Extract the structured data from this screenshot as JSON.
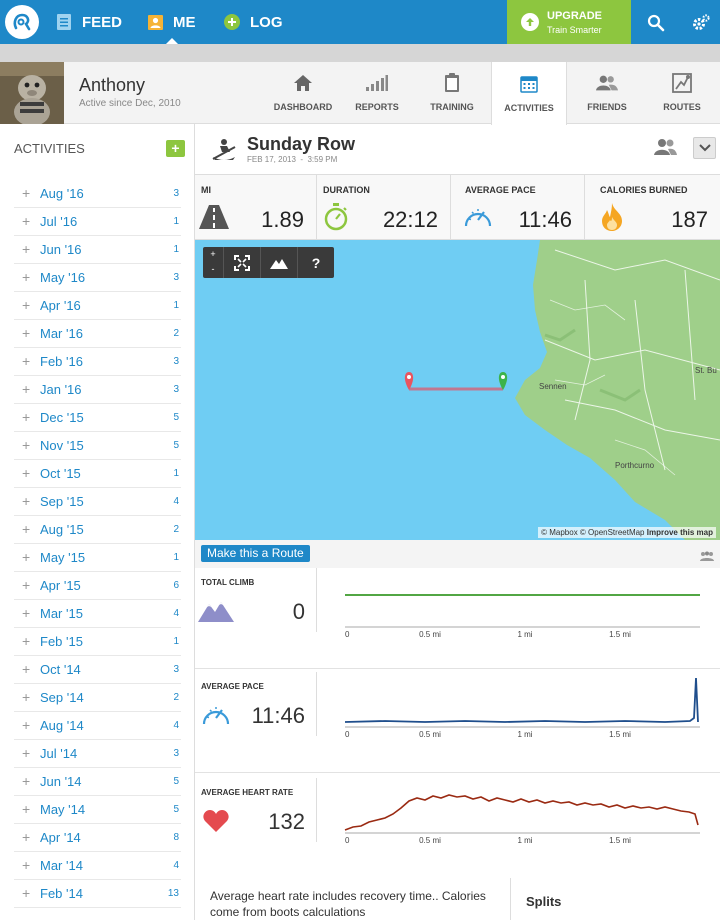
{
  "nav": {
    "feed": "FEED",
    "me": "ME",
    "log": "LOG",
    "upgrade_title": "UPGRADE",
    "upgrade_sub": "Train Smarter"
  },
  "profile": {
    "name": "Anthony",
    "since": "Active since Dec, 2010"
  },
  "tabs": [
    {
      "label": "DASHBOARD"
    },
    {
      "label": "REPORTS"
    },
    {
      "label": "TRAINING"
    },
    {
      "label": "ACTIVITIES"
    },
    {
      "label": "FRIENDS"
    },
    {
      "label": "ROUTES"
    }
  ],
  "sidebar": {
    "title": "ACTIVITIES",
    "add": "+",
    "items": [
      {
        "label": "Aug '16",
        "count": "3"
      },
      {
        "label": "Jul '16",
        "count": "1"
      },
      {
        "label": "Jun '16",
        "count": "1"
      },
      {
        "label": "May '16",
        "count": "3"
      },
      {
        "label": "Apr '16",
        "count": "1"
      },
      {
        "label": "Mar '16",
        "count": "2"
      },
      {
        "label": "Feb '16",
        "count": "3"
      },
      {
        "label": "Jan '16",
        "count": "3"
      },
      {
        "label": "Dec '15",
        "count": "5"
      },
      {
        "label": "Nov '15",
        "count": "5"
      },
      {
        "label": "Oct '15",
        "count": "1"
      },
      {
        "label": "Sep '15",
        "count": "4"
      },
      {
        "label": "Aug '15",
        "count": "2"
      },
      {
        "label": "May '15",
        "count": "1"
      },
      {
        "label": "Apr '15",
        "count": "6"
      },
      {
        "label": "Mar '15",
        "count": "4"
      },
      {
        "label": "Feb '15",
        "count": "1"
      },
      {
        "label": "Oct '14",
        "count": "3"
      },
      {
        "label": "Sep '14",
        "count": "2"
      },
      {
        "label": "Aug '14",
        "count": "4"
      },
      {
        "label": "Jul '14",
        "count": "3"
      },
      {
        "label": "Jun '14",
        "count": "5"
      },
      {
        "label": "May '14",
        "count": "5"
      },
      {
        "label": "Apr '14",
        "count": "8"
      },
      {
        "label": "Mar '14",
        "count": "4"
      },
      {
        "label": "Feb '14",
        "count": "13"
      }
    ]
  },
  "activity": {
    "title": "Sunday Row",
    "date": "FEB 17, 2013",
    "time": "3:59 PM"
  },
  "stats": {
    "mi": {
      "label": "MI",
      "value": "1.89"
    },
    "duration": {
      "label": "DURATION",
      "value": "22:12"
    },
    "pace": {
      "label": "AVERAGE PACE",
      "value": "11:46"
    },
    "calories": {
      "label": "CALORIES BURNED",
      "value": "187"
    }
  },
  "map": {
    "zoom_in": "+",
    "zoom_out": "-",
    "help": "?",
    "attribution_a": "© Mapbox © OpenStreetMap",
    "attribution_b": "Improve this map",
    "places": [
      "Sennen",
      "St. Bu",
      "Porthcurno"
    ]
  },
  "route": {
    "button": "Make this a Route"
  },
  "metrics": {
    "climb": {
      "label": "TOTAL CLIMB",
      "value": "0"
    },
    "pace": {
      "label": "AVERAGE PACE",
      "value": "11:46"
    },
    "hr": {
      "label": "AVERAGE HEART RATE",
      "value": "132"
    }
  },
  "axis_ticks": [
    "0",
    "0.5 mi",
    "1 mi",
    "1.5 mi"
  ],
  "note": "Average heart rate includes recovery time.. Calories come from boots calculations",
  "splits": "Splits",
  "colors": {
    "brand_blue": "#1e88c8",
    "upgrade_green": "#8dc63f",
    "climb_line": "#3a9a2a",
    "pace_line": "#1f4e8c",
    "hr_line": "#9a2a12",
    "water": "#6fcdf3",
    "land": "#9fcf8a"
  }
}
